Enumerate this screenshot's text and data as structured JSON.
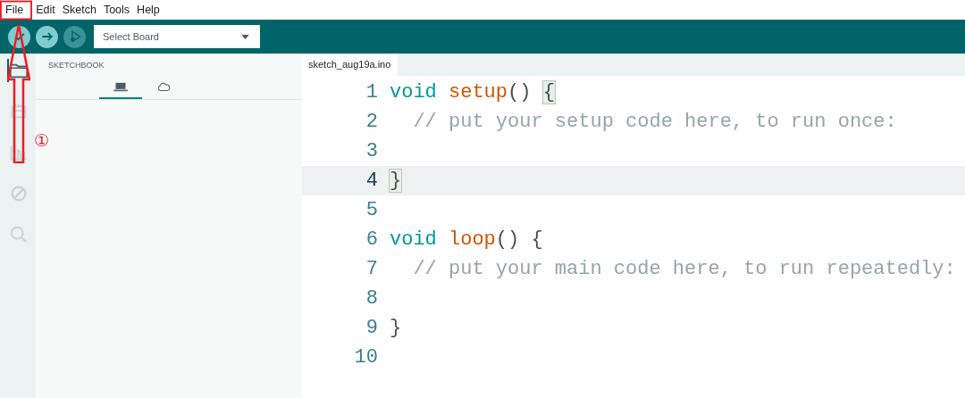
{
  "menu": [
    {
      "label": "File"
    },
    {
      "label": "Edit"
    },
    {
      "label": "Sketch"
    },
    {
      "label": "Tools"
    },
    {
      "label": "Help"
    }
  ],
  "toolbar": {
    "board_select": {
      "value": "Select Board"
    }
  },
  "activity_bar": [
    {
      "kind": "folder",
      "selected": true
    },
    {
      "kind": "board",
      "selected": false
    },
    {
      "kind": "library",
      "selected": false
    },
    {
      "kind": "debug",
      "selected": false
    },
    {
      "kind": "search",
      "selected": false
    }
  ],
  "sidebar": {
    "title": "SKETCHBOOK",
    "tabs": [
      {
        "kind": "local",
        "selected": true
      },
      {
        "kind": "cloud",
        "selected": false
      }
    ]
  },
  "editor": {
    "tabs": [
      {
        "label": "sketch_aug19a.ino",
        "selected": true
      }
    ],
    "lines": [
      {
        "number": "1",
        "current": false,
        "tokens": [
          {
            "kind": "keyword",
            "text": "void"
          },
          {
            "kind": "function",
            "text": "setup"
          },
          {
            "kind": "punct",
            "text": "() "
          },
          {
            "kind": "bracket",
            "text": "{"
          }
        ]
      },
      {
        "number": "2",
        "current": false,
        "tokens": [
          {
            "kind": "comment",
            "text": "  // put your setup code here, to run once:"
          }
        ]
      },
      {
        "number": "3",
        "current": false
      },
      {
        "number": "4",
        "current": true,
        "tokens": [
          {
            "kind": "bracket",
            "text": "}"
          }
        ]
      },
      {
        "number": "5",
        "current": false
      },
      {
        "number": "6",
        "current": false,
        "tokens": [
          {
            "kind": "keyword",
            "text": "void"
          },
          {
            "kind": "function",
            "text": "loop"
          },
          {
            "kind": "punct",
            "text": "() {"
          }
        ]
      },
      {
        "number": "7",
        "current": false,
        "tokens": [
          {
            "kind": "comment",
            "text": "  // put your main code here, to run repeatedly:"
          }
        ]
      },
      {
        "number": "8",
        "current": false
      },
      {
        "number": "9",
        "current": false,
        "tokens": [
          {
            "kind": "punct",
            "text": "}"
          }
        ]
      },
      {
        "number": "10",
        "current": false
      }
    ]
  },
  "annotation": {
    "label": "①"
  }
}
